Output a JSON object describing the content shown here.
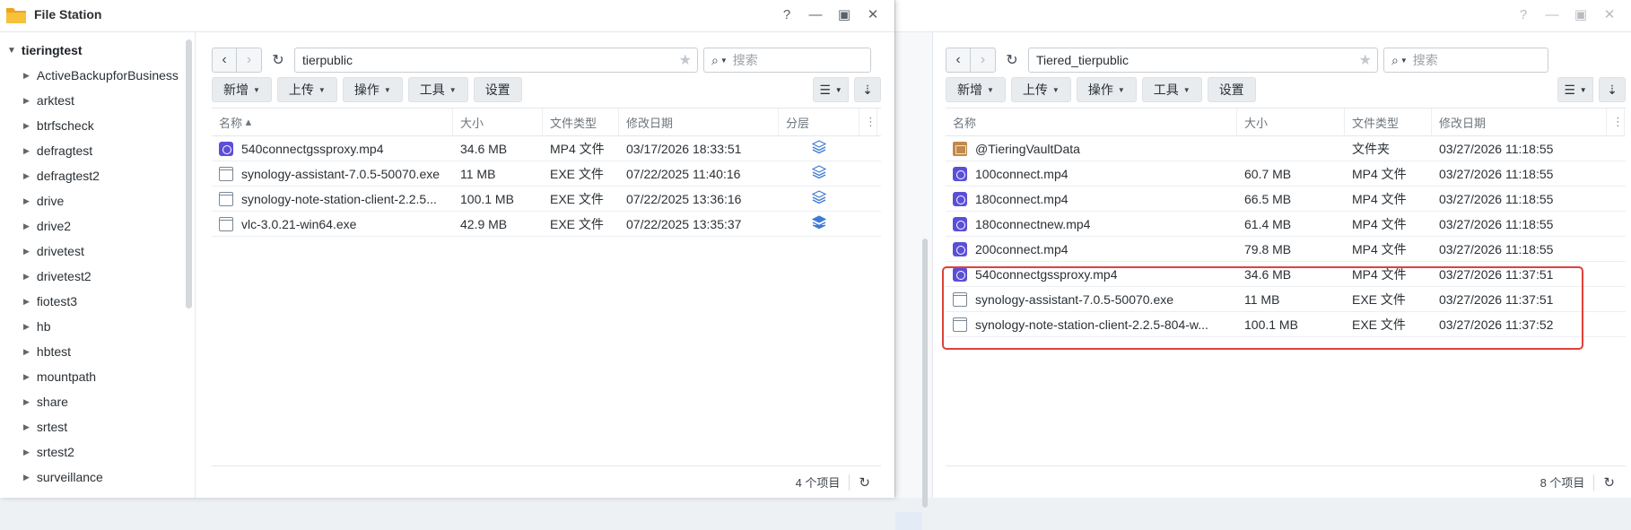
{
  "front": {
    "app_title": "File Station",
    "controls": [
      "?",
      "—",
      "▣",
      "✕"
    ],
    "sidebar": {
      "root": "tieringtest",
      "items": [
        "ActiveBackupforBusiness",
        "arktest",
        "btrfscheck",
        "defragtest",
        "defragtest2",
        "drive",
        "drive2",
        "drivetest",
        "drivetest2",
        "fiotest3",
        "hb",
        "hbtest",
        "mountpath",
        "share",
        "srtest",
        "srtest2",
        "surveillance"
      ]
    },
    "path": "tierpublic",
    "search_placeholder": "搜索",
    "toolbar": {
      "create": "新增",
      "upload": "上传",
      "action": "操作",
      "tools": "工具",
      "settings": "设置"
    },
    "columns": {
      "name": "名称",
      "size": "大小",
      "type": "文件类型",
      "modified": "修改日期",
      "tier": "分层"
    },
    "sort_glyph": "▴",
    "rows": [
      {
        "name": "540connectgssproxy.mp4",
        "size": "34.6 MB",
        "type": "MP4 文件",
        "modified": "03/17/2026 18:33:51",
        "kind": "mp4",
        "tier_icon": "layers-outline-icon"
      },
      {
        "name": "synology-assistant-7.0.5-50070.exe",
        "size": "11 MB",
        "type": "EXE 文件",
        "modified": "07/22/2025 11:40:16",
        "kind": "exe",
        "tier_icon": "layers-outline-icon"
      },
      {
        "name": "synology-note-station-client-2.2.5...",
        "size": "100.1 MB",
        "type": "EXE 文件",
        "modified": "07/22/2025 13:36:16",
        "kind": "exe",
        "tier_icon": "layers-outline-icon"
      },
      {
        "name": "vlc-3.0.21-win64.exe",
        "size": "42.9 MB",
        "type": "EXE 文件",
        "modified": "07/22/2025 13:35:37",
        "kind": "exe",
        "tier_icon": "layers-filled-icon"
      }
    ],
    "footer": "4 个项目"
  },
  "back": {
    "controls": [
      "?",
      "—",
      "▣",
      "✕"
    ],
    "path": "Tiered_tierpublic",
    "search_placeholder": "搜索",
    "toolbar": {
      "create": "新增",
      "upload": "上传",
      "action": "操作",
      "tools": "工具",
      "settings": "设置"
    },
    "columns": {
      "name": "名称",
      "size": "大小",
      "type": "文件类型",
      "modified": "修改日期"
    },
    "rows": [
      {
        "name": "@TieringVaultData",
        "size": "",
        "type": "文件夹",
        "modified": "03/27/2026 11:18:55",
        "kind": "folder"
      },
      {
        "name": "100connect.mp4",
        "size": "60.7 MB",
        "type": "MP4 文件",
        "modified": "03/27/2026 11:18:55",
        "kind": "mp4"
      },
      {
        "name": "180connect.mp4",
        "size": "66.5 MB",
        "type": "MP4 文件",
        "modified": "03/27/2026 11:18:55",
        "kind": "mp4"
      },
      {
        "name": "180connectnew.mp4",
        "size": "61.4 MB",
        "type": "MP4 文件",
        "modified": "03/27/2026 11:18:55",
        "kind": "mp4"
      },
      {
        "name": "200connect.mp4",
        "size": "79.8 MB",
        "type": "MP4 文件",
        "modified": "03/27/2026 11:18:55",
        "kind": "mp4"
      },
      {
        "name": "540connectgssproxy.mp4",
        "size": "34.6 MB",
        "type": "MP4 文件",
        "modified": "03/27/2026 11:37:51",
        "kind": "mp4"
      },
      {
        "name": "synology-assistant-7.0.5-50070.exe",
        "size": "11 MB",
        "type": "EXE 文件",
        "modified": "03/27/2026 11:37:51",
        "kind": "exe"
      },
      {
        "name": "synology-note-station-client-2.2.5-804-w...",
        "size": "100.1 MB",
        "type": "EXE 文件",
        "modified": "03/27/2026 11:37:52",
        "kind": "exe"
      }
    ],
    "footer": "8 个项目"
  },
  "colors": {
    "accent": "#3e7bd6",
    "highlight": "#e0403a",
    "mp4_icon": "#5b4fd8",
    "folder_icon": "#c08a4a"
  }
}
